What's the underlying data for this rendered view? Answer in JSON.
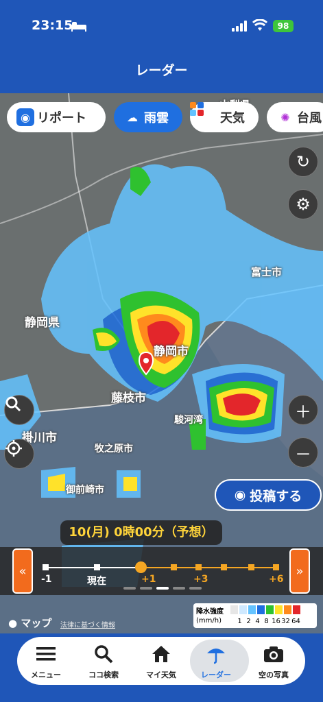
{
  "status": {
    "time": "23:15",
    "battery": "98"
  },
  "header": {
    "title": "レーダー"
  },
  "chips": [
    {
      "label": "リポート"
    },
    {
      "label": "雨雲"
    },
    {
      "label": "天気"
    },
    {
      "label": "台風"
    }
  ],
  "map": {
    "labels": {
      "shizuoka_pref": "静岡県",
      "shizuoka_city": "静岡市",
      "fujieda": "藤枝市",
      "kakegawa": "掛川市",
      "makinohara": "牧之原市",
      "fuji": "富士市",
      "omaezaki": "御前崎市",
      "suruga_bay": "駿河湾",
      "top_pref": "山梨県"
    }
  },
  "post_button": {
    "label": "投稿する"
  },
  "timestamp": "10(月) 0時00分（予想）",
  "timeline": {
    "labels": {
      "m1": "-1",
      "now": "現在",
      "p1": "+1",
      "p3": "+3",
      "p6": "+6"
    }
  },
  "legend": {
    "title": "降水強度",
    "unit": "(mm/h)",
    "values": [
      "1",
      "2",
      "4",
      "8",
      "16",
      "32",
      "64"
    ],
    "colors": [
      "#e6e6e6",
      "#cfe9ff",
      "#64c3ff",
      "#1f6fe0",
      "#2fc12f",
      "#ffe22a",
      "#ff8a1d",
      "#e3262b"
    ]
  },
  "attribution": {
    "brand": "マップ",
    "legal": "法律に基づく情報"
  },
  "tabs": [
    {
      "label": "メニュー"
    },
    {
      "label": "ココ検索"
    },
    {
      "label": "マイ天気"
    },
    {
      "label": "レーダー"
    },
    {
      "label": "空の写真"
    }
  ]
}
